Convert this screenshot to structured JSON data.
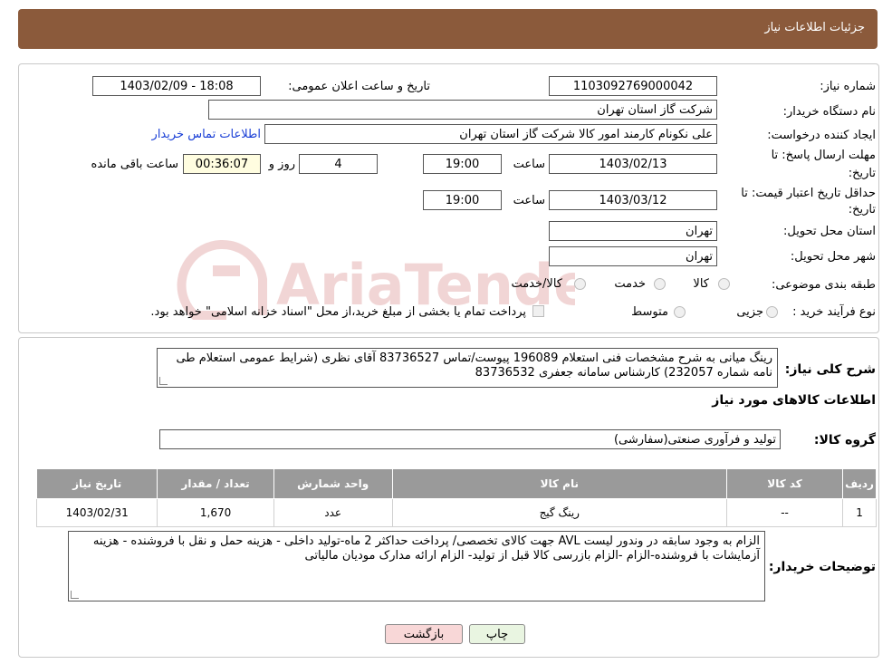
{
  "header": {
    "title": "جزئیات اطلاعات نیاز"
  },
  "form": {
    "need_number_label": "شماره نیاز:",
    "need_number": "1103092769000042",
    "announce_label": "تاریخ و ساعت اعلان عمومی:",
    "announce_value": "1403/02/09 - 18:08",
    "buyer_org_label": "نام دستگاه خریدار:",
    "buyer_org": "شرکت گاز استان تهران",
    "creator_label": "ایجاد کننده درخواست:",
    "creator": "علی نکونام کارمند امور کالا شرکت گاز استان تهران",
    "contact_link": "اطلاعات تماس خریدار",
    "deadline_label_1": "مهلت ارسال پاسخ: تا",
    "deadline_label_2": "تاریخ:",
    "deadline_date": "1403/02/13",
    "hour_label": "ساعت",
    "deadline_time": "19:00",
    "days": "4",
    "days_label": "روز و",
    "remaining_time": "00:36:07",
    "remaining_label": "ساعت باقی مانده",
    "validity_label_1": "حداقل تاریخ اعتبار قیمت: تا",
    "validity_label_2": "تاریخ:",
    "validity_date": "1403/03/12",
    "validity_time": "19:00",
    "province_label": "استان محل تحویل:",
    "province": "تهران",
    "city_label": "شهر محل تحویل:",
    "city": "تهران",
    "category_label": "طبقه بندی موضوعی:",
    "category_options": [
      "کالا",
      "خدمت",
      "کالا/خدمت"
    ],
    "process_label": "نوع فرآیند خرید :",
    "process_options": [
      "جزیی",
      "متوسط"
    ],
    "process_note": "پرداخت تمام یا بخشی از مبلغ خرید،از محل \"اسناد خزانه اسلامی\" خواهد بود."
  },
  "description": {
    "label": "شرح کلی نیاز:",
    "text": "رینگ میانی به شرح مشخصات فنی استعلام 196089 پیوست/تماس 83736527 آقای نظری (شرایط عمومی استعلام طی نامه شماره 232057) کارشناس سامانه جعفری 83736532"
  },
  "goods": {
    "section_title": "اطلاعات کالاهای مورد نیاز",
    "group_label": "گروه کالا:",
    "group_value": "تولید و فرآوری صنعتی(سفارشی)",
    "columns": [
      "ردیف",
      "کد کالا",
      "نام کالا",
      "واحد شمارش",
      "تعداد / مقدار",
      "تاریخ نیاز"
    ],
    "rows": [
      {
        "row": "1",
        "code": "--",
        "name": "رینگ گیج",
        "unit": "عدد",
        "qty": "1,670",
        "date": "1403/02/31"
      }
    ]
  },
  "buyer_notes": {
    "label": "توضیحات خریدار:",
    "text": "الزام به وجود سابقه در وندور لیست AVL جهت کالای تخصصی/ پرداخت حداکثر 2 ماه-تولید داخلی - هزینه حمل و نقل با فروشنده - هزینه آزمایشات با فروشنده-الزام  -الزام بازرسی کالا قبل از تولید- الزام ارائه مدارک مودیان مالیاتی"
  },
  "buttons": {
    "print": "چاپ",
    "back": "بازگشت"
  },
  "watermark_text": "AriaTender.neT",
  "colors": {
    "header": "#8b5a3b",
    "table_head": "#9a9a9a",
    "back_button": "#f8d7d7",
    "print_button": "#e9f5e1"
  }
}
